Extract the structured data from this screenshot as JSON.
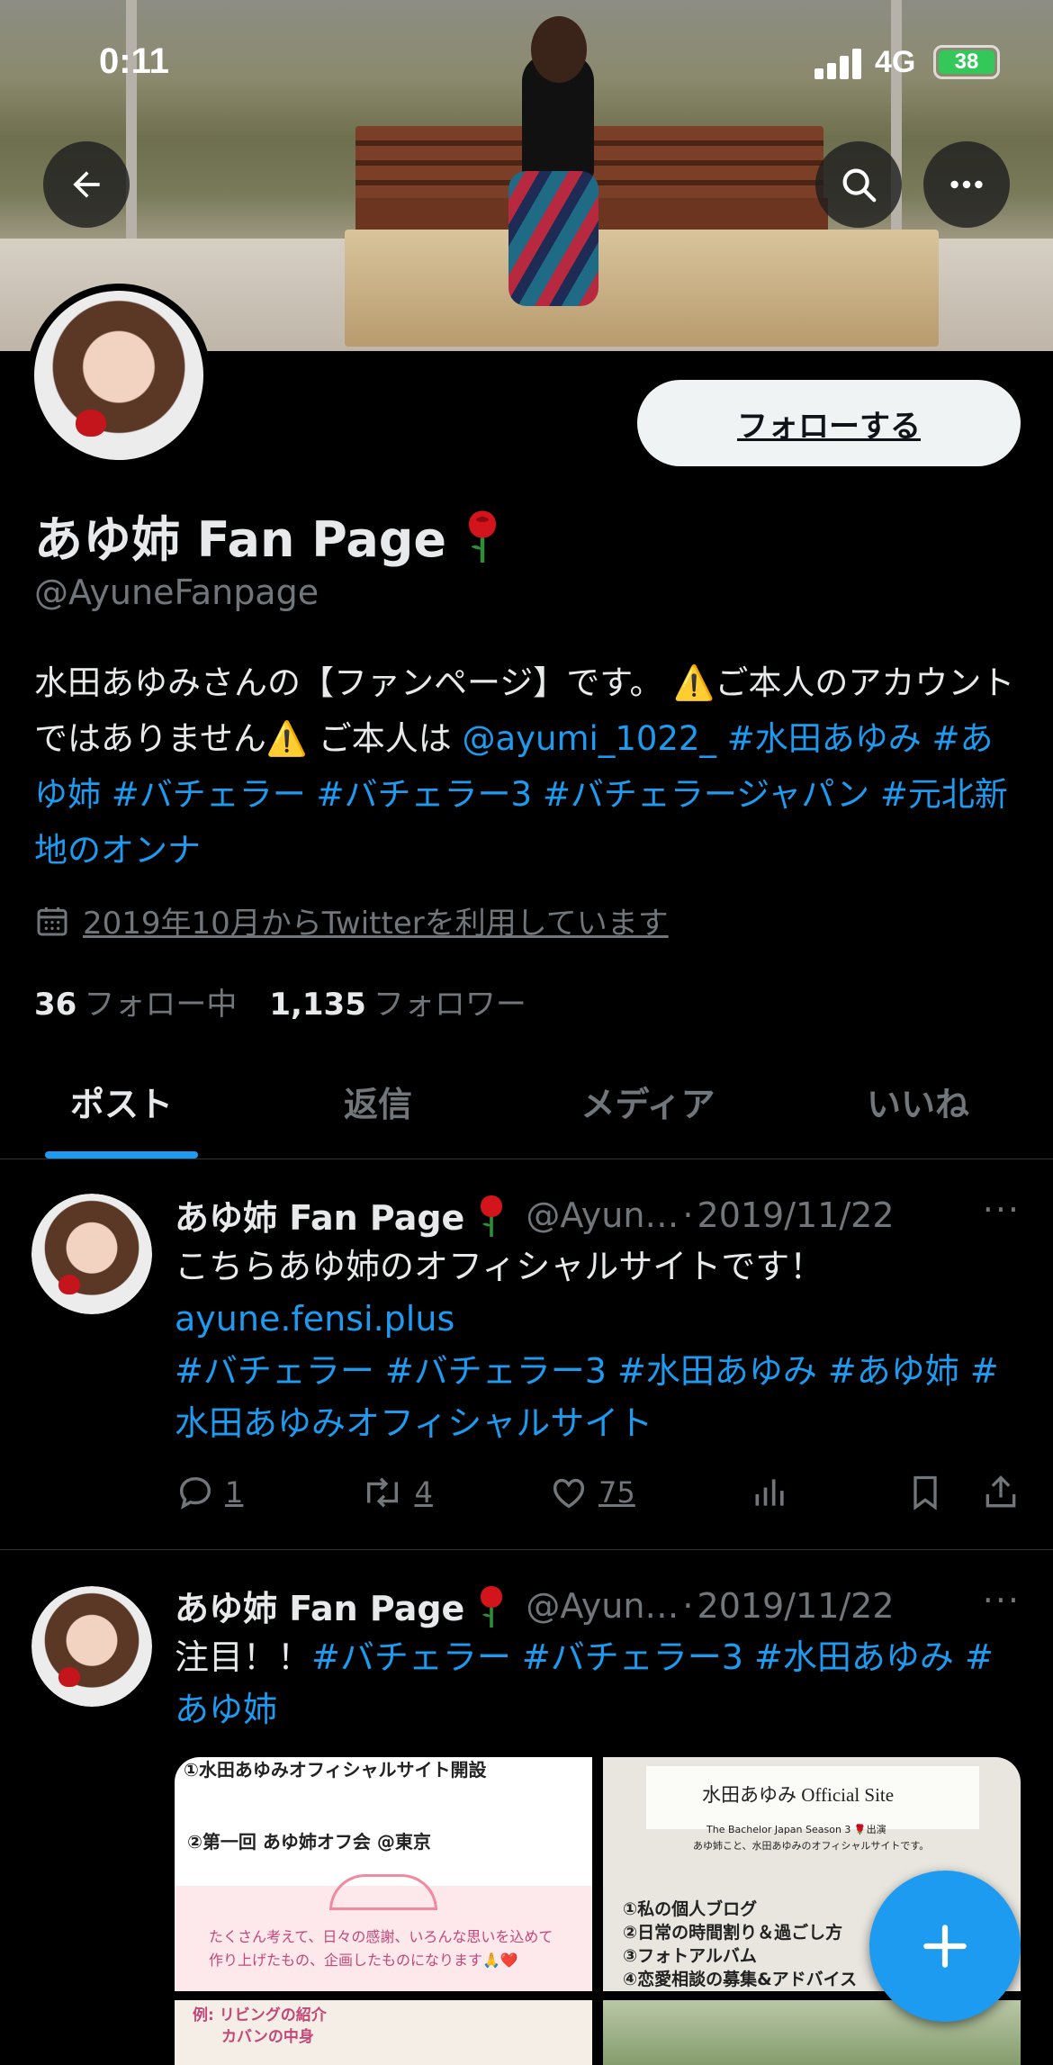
{
  "status_bar": {
    "time": "0:11",
    "network": "4G",
    "battery": "38"
  },
  "profile": {
    "display_name": "あゆ姉 Fan Page",
    "handle": "@AyuneFanpage",
    "follow_button": "フォローする",
    "bio": {
      "text1": "水田あゆみさんの【ファンページ】です。 ⚠️ご本人のアカウントではありません⚠️ ご本人は ",
      "mention": "@ayumi_1022_",
      "hashtags": "#水田あゆみ #あゆ姉 #バチェラー #バチェラー3 #バチェラージャパン #元北新地のオンナ"
    },
    "joined": "2019年10月からTwitterを利用しています",
    "following_count": "36",
    "following_label": "フォロー中",
    "followers_count": "1,135",
    "followers_label": "フォロワー"
  },
  "tabs": [
    {
      "label": "ポスト",
      "active": true
    },
    {
      "label": "返信",
      "active": false
    },
    {
      "label": "メディア",
      "active": false
    },
    {
      "label": "いいね",
      "active": false
    }
  ],
  "posts": [
    {
      "name": "あゆ姉 Fan Page",
      "handle": "@Ayun…",
      "date": "2019/11/22",
      "text": "こちらあゆ姉のオフィシャルサイトです！",
      "link": "ayune.fensi.plus",
      "hashtags": "#バチェラー #バチェラー3 #水田あゆみ #あゆ姉 #水田あゆみオフィシャルサイト",
      "replies": "1",
      "retweets": "4",
      "likes": "75"
    },
    {
      "name": "あゆ姉 Fan Page",
      "handle": "@Ayun…",
      "date": "2019/11/22",
      "text": "注目！！",
      "hashtags": "#バチェラー #バチェラー3 #水田あゆみ #あゆ姉",
      "media": {
        "img1_line1": "①水田あゆみオフィシャルサイト開設",
        "img1_line2": "②第一回 あゆ姉オフ会 @東京",
        "img1_line3": "たくさん考えて、日々の感謝、いろんな思いを込めて",
        "img1_line4": "作り上げたもの、企画したものになります🙏❤️",
        "img1_line5": "例: リビングの紹介",
        "img1_line6": "カバンの中身",
        "img2_title": "水田あゆみ Official Site",
        "img2_sub": "The Bachelor Japan Season 3 🌹出演",
        "img2_sub2": "あゆ姉こと、水田あゆみのオフィシャルサイトです。",
        "img2_item1": "①私の個人ブログ",
        "img2_item2": "②日常の時間割り＆過ごし方",
        "img2_item3": "③フォトアルバム",
        "img2_item4": "④恋愛相談の募集&アドバイス"
      }
    }
  ],
  "colors": {
    "accent": "#1d9bf0",
    "background": "#000000",
    "secondary_text": "#71767b",
    "rose": "#c4151c"
  }
}
